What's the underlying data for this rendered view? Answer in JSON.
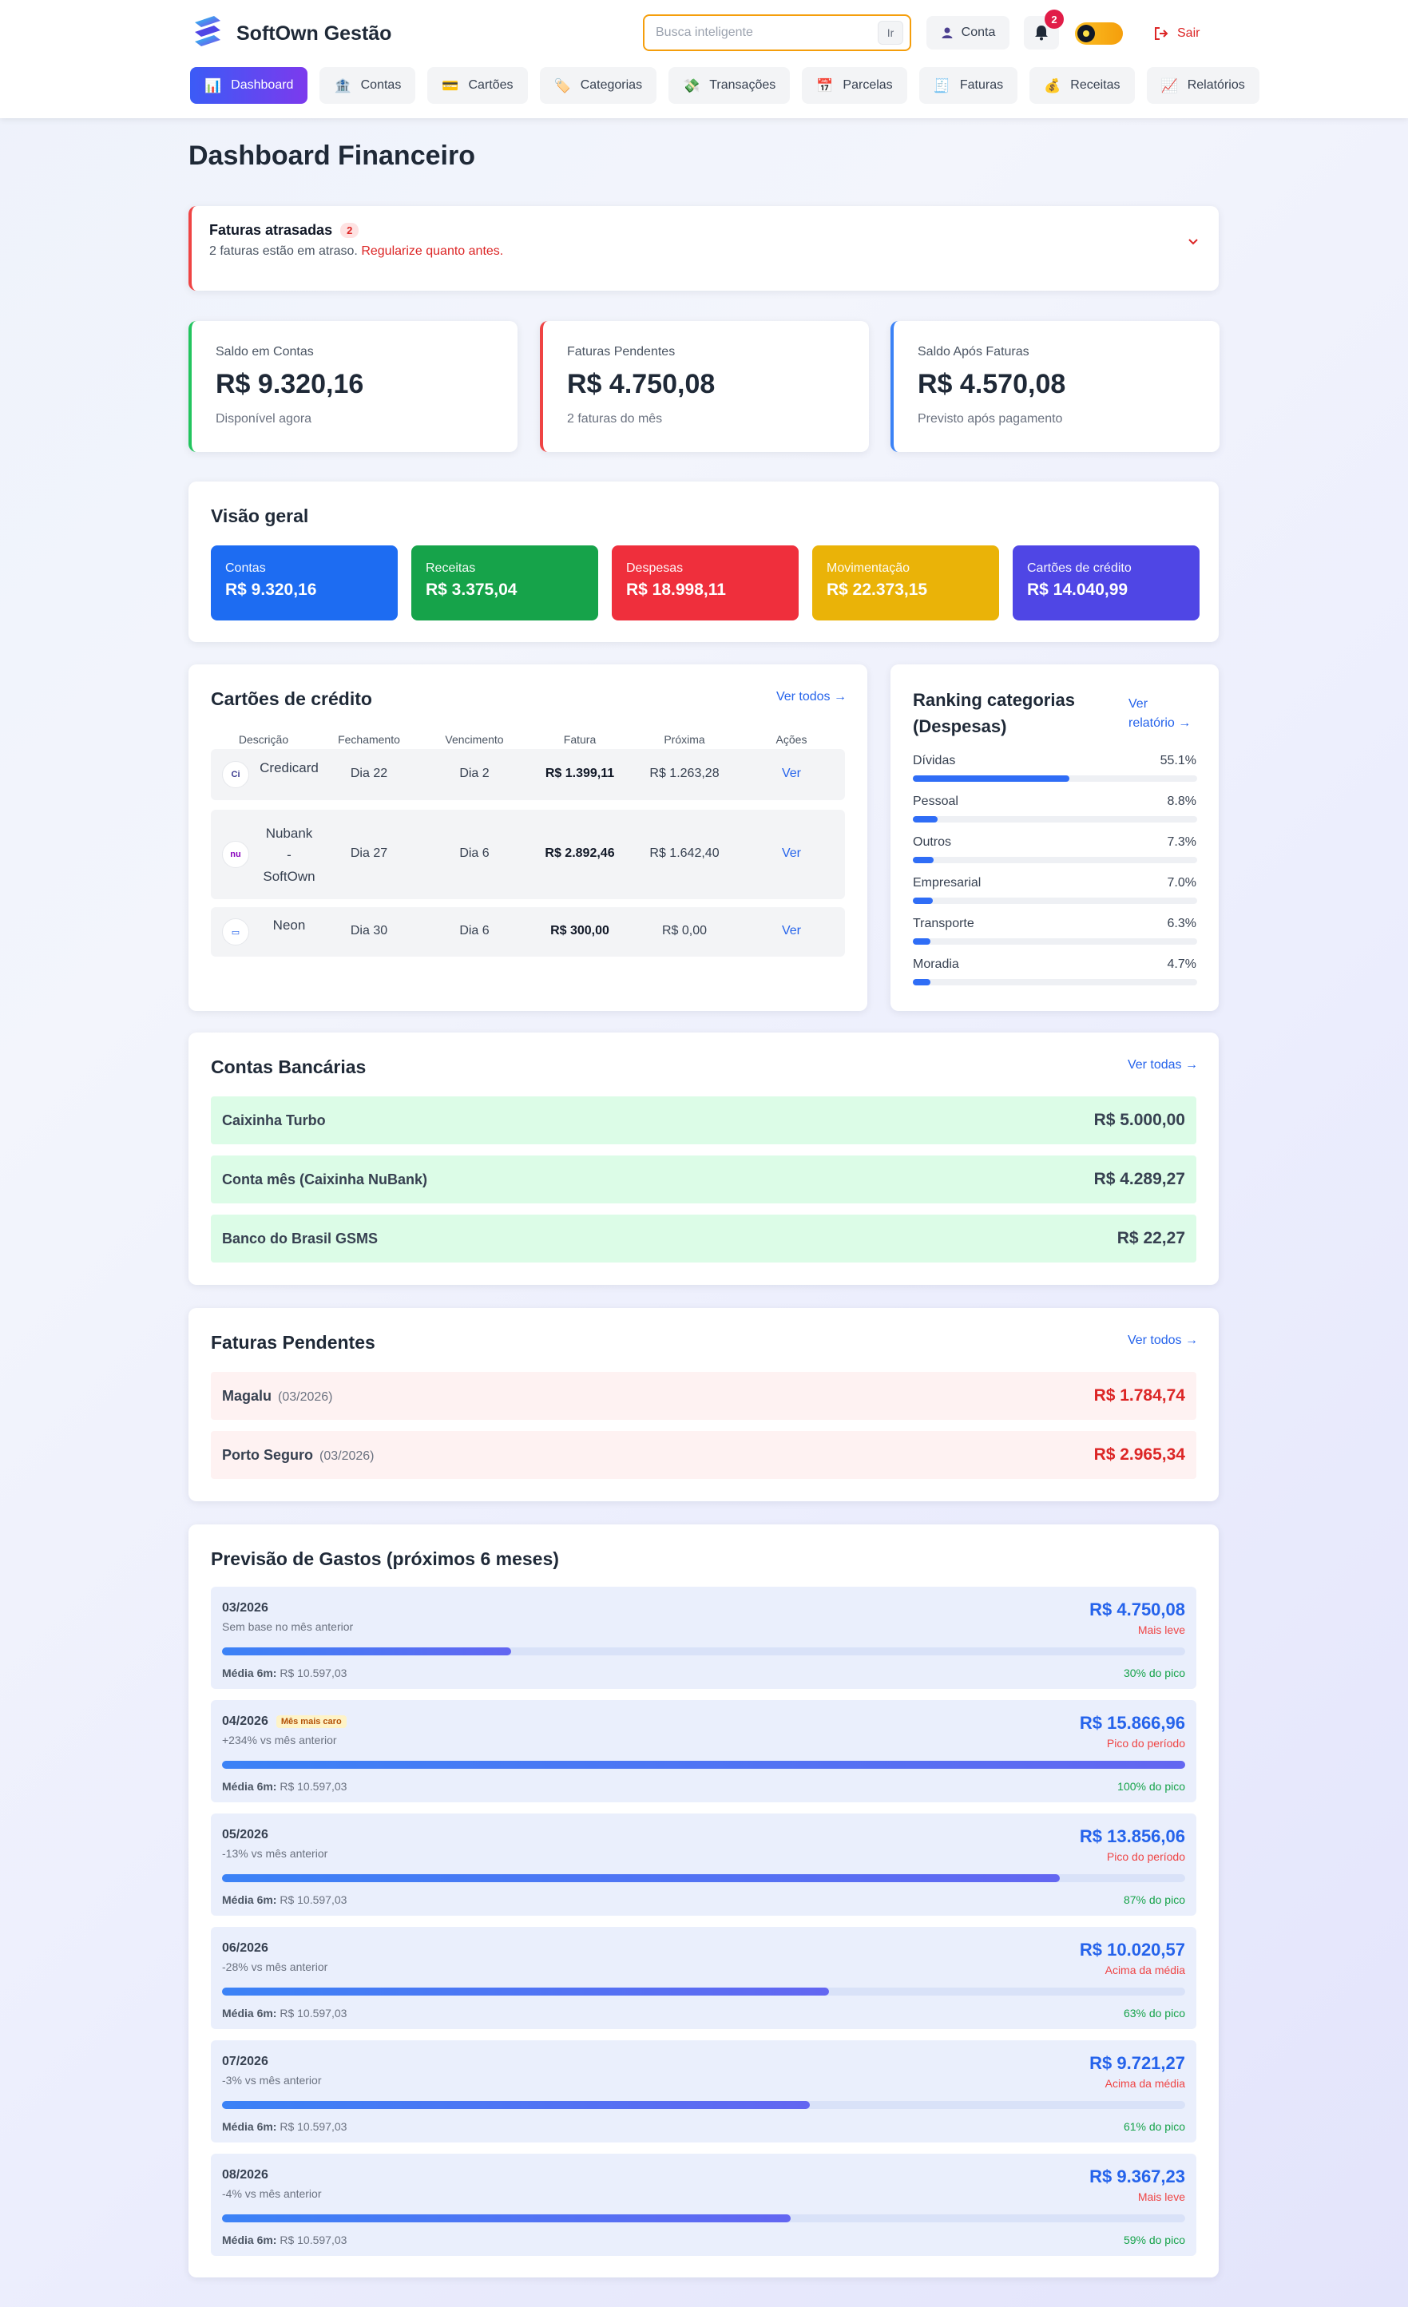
{
  "app": {
    "name": "SoftOwn Gestão",
    "search_placeholder": "Busca inteligente",
    "search_button": "Ir",
    "account_label": "Conta",
    "notification_count": "2",
    "logout_label": "Sair"
  },
  "nav": [
    {
      "label": "Dashboard",
      "icon": "📊",
      "active": true
    },
    {
      "label": "Contas",
      "icon": "🏦"
    },
    {
      "label": "Cartões",
      "icon": "💳"
    },
    {
      "label": "Categorias",
      "icon": "🏷️"
    },
    {
      "label": "Transações",
      "icon": "💸"
    },
    {
      "label": "Parcelas",
      "icon": "📅"
    },
    {
      "label": "Faturas",
      "icon": "🧾"
    },
    {
      "label": "Receitas",
      "icon": "💰"
    },
    {
      "label": "Relatórios",
      "icon": "📈"
    }
  ],
  "page": {
    "title": "Dashboard Financeiro"
  },
  "alert": {
    "title": "Faturas atrasadas",
    "count": "2",
    "desc": "2 faturas estão em atraso.",
    "desc_highlight": "Regularize quanto antes."
  },
  "stats": [
    {
      "label": "Saldo em Contas",
      "value": "R$ 9.320,16",
      "sub": "Disponível agora",
      "color": "#22c55e"
    },
    {
      "label": "Faturas Pendentes",
      "value": "R$ 4.750,08",
      "sub": "2 faturas do mês",
      "color": "#ef4444"
    },
    {
      "label": "Saldo Após Faturas",
      "value": "R$ 4.570,08",
      "sub": "Previsto após pagamento",
      "color": "#3b82f6"
    }
  ],
  "overview": {
    "title": "Visão geral",
    "tiles": [
      {
        "label": "Contas",
        "value": "R$ 9.320,16",
        "color": "#1d6cf2"
      },
      {
        "label": "Receitas",
        "value": "R$ 3.375,04",
        "color": "#16a34a"
      },
      {
        "label": "Despesas",
        "value": "R$ 18.998,11",
        "color": "#ef2f3c"
      },
      {
        "label": "Movimentação",
        "value": "R$ 22.373,15",
        "color": "#eab308"
      },
      {
        "label": "Cartões de crédito",
        "value": "R$ 14.040,99",
        "color": "#4f46e5"
      }
    ]
  },
  "credit_cards": {
    "title": "Cartões de crédito",
    "link": "Ver todos →",
    "headers": [
      "Descrição",
      "Fechamento",
      "Vencimento",
      "Fatura",
      "Próxima",
      "Ações"
    ],
    "rows": [
      {
        "name": "Credicard",
        "logo": "Ci",
        "closing": "Dia 22",
        "due": "Dia 2",
        "invoice": "R$ 1.399,11",
        "next": "R$ 1.263,28",
        "action": "Ver"
      },
      {
        "name": "Nubank - SoftOwn",
        "name_lines": [
          "Nubank",
          "-",
          "SoftOwn"
        ],
        "logo": "nu",
        "closing": "Dia 27",
        "due": "Dia 6",
        "invoice": "R$ 2.892,46",
        "next": "R$ 1.642,40",
        "action": "Ver"
      },
      {
        "name": "Neon",
        "logo": "▭",
        "closing": "Dia 30",
        "due": "Dia 6",
        "invoice": "R$ 300,00",
        "next": "R$ 0,00",
        "action": "Ver"
      }
    ]
  },
  "ranking": {
    "title_line1": "Ranking categorias",
    "title_line2": "(Despesas)",
    "link_line1": "Ver",
    "link_line2": "relatório →",
    "items": [
      {
        "label": "Dívidas",
        "pct": "55.1%",
        "value": 55.1
      },
      {
        "label": "Pessoal",
        "pct": "8.8%",
        "value": 8.8
      },
      {
        "label": "Outros",
        "pct": "7.3%",
        "value": 7.3
      },
      {
        "label": "Empresarial",
        "pct": "7.0%",
        "value": 7.0
      },
      {
        "label": "Transporte",
        "pct": "6.3%",
        "value": 6.3
      },
      {
        "label": "Moradia",
        "pct": "4.7%",
        "value": 4.7
      }
    ]
  },
  "bank_accounts": {
    "title": "Contas Bancárias",
    "link": "Ver todas →",
    "rows": [
      {
        "name": "Caixinha Turbo",
        "value": "R$ 5.000,00"
      },
      {
        "name": "Conta mês (Caixinha NuBank)",
        "value": "R$ 4.289,27"
      },
      {
        "name": "Banco do Brasil GSMS",
        "value": "R$ 22,27"
      }
    ]
  },
  "pending_invoices": {
    "title": "Faturas Pendentes",
    "link": "Ver todos →",
    "rows": [
      {
        "name": "Magalu",
        "period": "(03/2026)",
        "value": "R$ 1.784,74"
      },
      {
        "name": "Porto Seguro",
        "period": "(03/2026)",
        "value": "R$ 2.965,34"
      }
    ]
  },
  "forecast": {
    "title": "Previsão de Gastos (próximos 6 meses)",
    "avg_label": "Média 6m:",
    "avg_value": "R$ 10.597,03",
    "rows": [
      {
        "month": "03/2026",
        "tag": "",
        "sub": "Sem base no mês anterior",
        "value": "R$ 4.750,08",
        "note": "Mais leve",
        "peak": "30% do pico",
        "level": 0.3
      },
      {
        "month": "04/2026",
        "tag": "Mês mais caro",
        "sub": "+234% vs mês anterior",
        "value": "R$ 15.866,96",
        "note": "Pico do período",
        "peak": "100% do pico",
        "level": 1.0
      },
      {
        "month": "05/2026",
        "tag": "",
        "sub": "-13% vs mês anterior",
        "value": "R$ 13.856,06",
        "note": "Pico do período",
        "peak": "87% do pico",
        "level": 0.87
      },
      {
        "month": "06/2026",
        "tag": "",
        "sub": "-28% vs mês anterior",
        "value": "R$ 10.020,57",
        "note": "Acima da média",
        "peak": "63% do pico",
        "level": 0.63
      },
      {
        "month": "07/2026",
        "tag": "",
        "sub": "-3% vs mês anterior",
        "value": "R$ 9.721,27",
        "note": "Acima da média",
        "peak": "61% do pico",
        "level": 0.61
      },
      {
        "month": "08/2026",
        "tag": "",
        "sub": "-4% vs mês anterior",
        "value": "R$ 9.367,23",
        "note": "Mais leve",
        "peak": "59% do pico",
        "level": 0.59
      }
    ]
  }
}
